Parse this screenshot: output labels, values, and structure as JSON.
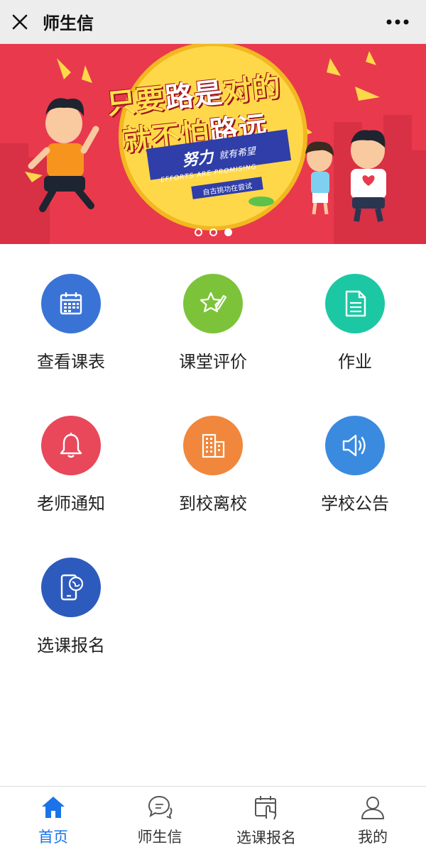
{
  "topbar": {
    "title": "师生信",
    "close_icon": "close-icon",
    "more_icon": "more-dots-icon"
  },
  "banner": {
    "slogan_line1_a": "只要",
    "slogan_line1_b": "路是",
    "slogan_line1_c": "对的",
    "slogan_line2_a": "就不怕",
    "slogan_line2_b": "路远",
    "ribbon_big": "努力",
    "ribbon_small": "就有希望",
    "ribbon_en": "EFFORTS ARE PROMISING",
    "ribbon_tag": "自古挑功在尝试",
    "dots_total": 3,
    "dots_active_index": 2,
    "colors": {
      "background": "#e9394d",
      "circle": "#ffd84a",
      "ribbon": "#2f3ea8"
    }
  },
  "grid": {
    "items": [
      {
        "label": "查看课表",
        "icon": "calendar-icon",
        "color": "#3a73d6"
      },
      {
        "label": "课堂评价",
        "icon": "star-pencil-icon",
        "color": "#7cc33a"
      },
      {
        "label": "作业",
        "icon": "document-icon",
        "color": "#1bc8a3"
      },
      {
        "label": "老师通知",
        "icon": "bell-icon",
        "color": "#e8485a"
      },
      {
        "label": "到校离校",
        "icon": "building-icon",
        "color": "#f0873c"
      },
      {
        "label": "学校公告",
        "icon": "speaker-icon",
        "color": "#3a8be0"
      },
      {
        "label": "选课报名",
        "icon": "phone-globe-icon",
        "color": "#2d5bbd"
      }
    ]
  },
  "bottom_nav": {
    "items": [
      {
        "label": "首页",
        "icon": "home-icon",
        "active": true
      },
      {
        "label": "师生信",
        "icon": "chat-bubbles-icon",
        "active": false
      },
      {
        "label": "选课报名",
        "icon": "calendar-touch-icon",
        "active": false
      },
      {
        "label": "我的",
        "icon": "user-icon",
        "active": false
      }
    ],
    "active_color": "#1a73e8"
  }
}
